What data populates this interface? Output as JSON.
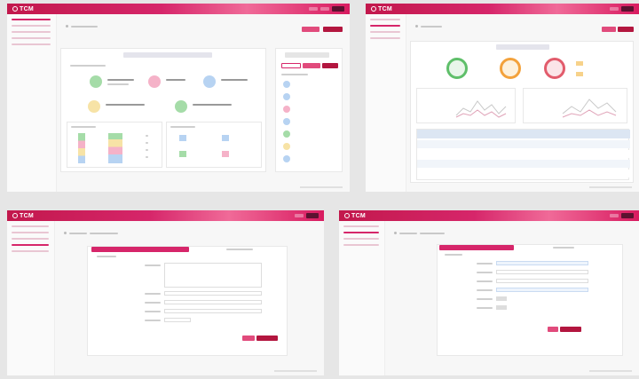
{
  "app": {
    "logo": "TCM"
  },
  "colors": {
    "brand": "#d6266a",
    "brand_dark": "#b3163f",
    "accent_light": "#f06a98"
  },
  "screens": [
    {
      "id": "dashboard",
      "stats_icons": [
        "green-circle-icon",
        "pink-circle-icon",
        "blue-circle-icon",
        "yellow-circle-icon",
        "green-circle-icon"
      ]
    },
    {
      "id": "analytics",
      "rings": [
        "green-ring-icon",
        "orange-ring-icon",
        "red-ring-icon"
      ]
    },
    {
      "id": "task-form"
    },
    {
      "id": "user-form"
    }
  ]
}
